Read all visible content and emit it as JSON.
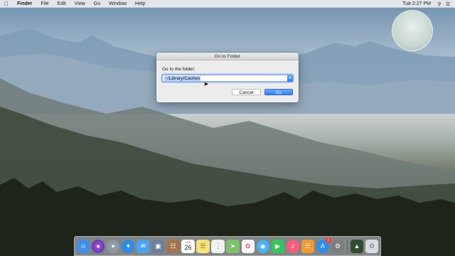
{
  "menubar": {
    "apple_icon": "apple-icon",
    "app_name": "Finder",
    "items": [
      "File",
      "Edit",
      "View",
      "Go",
      "Window",
      "Help"
    ],
    "clock": "Tue 2:27 PM"
  },
  "dialog": {
    "title": "Go to Folder",
    "prompt": "Go to the folder:",
    "path_value": "~/Library/Caches",
    "cancel_label": "Cancel",
    "go_label": "Go"
  },
  "dock": {
    "apps": [
      {
        "name": "finder-icon",
        "color": "#3f8ee8"
      },
      {
        "name": "siri-icon",
        "color": "#4b3fbf"
      },
      {
        "name": "launchpad-icon",
        "color": "#8a98a8"
      },
      {
        "name": "safari-icon",
        "color": "#2d8de6"
      },
      {
        "name": "mail-icon",
        "color": "#4aa4f2"
      },
      {
        "name": "photos-preview-icon",
        "color": "#6a7f9a"
      },
      {
        "name": "notes-book-icon",
        "color": "#a5744a"
      },
      {
        "name": "calendar-icon",
        "color": "#ffffff"
      },
      {
        "name": "notes-icon",
        "color": "#f5e27a"
      },
      {
        "name": "reminders-icon",
        "color": "#f2f2f2"
      },
      {
        "name": "maps-icon",
        "color": "#7bc26b"
      },
      {
        "name": "photos-icon",
        "color": "#f5f5f5"
      },
      {
        "name": "messages-icon",
        "color": "#45b3f5"
      },
      {
        "name": "facetime-icon",
        "color": "#37c45b"
      },
      {
        "name": "itunes-icon",
        "color": "#fb5a7a"
      },
      {
        "name": "ibooks-icon",
        "color": "#f19a2e"
      },
      {
        "name": "app-store-icon",
        "color": "#2e8ef0"
      },
      {
        "name": "system-preferences-icon",
        "color": "#7d7d7d"
      }
    ],
    "calendar_month": "JUN",
    "calendar_day": "26",
    "app_store_badge": "1",
    "extra": [
      {
        "name": "cleaner-app-icon",
        "color": "#2f4f2f"
      },
      {
        "name": "trash-icon",
        "color": "#d9dde2"
      }
    ]
  }
}
